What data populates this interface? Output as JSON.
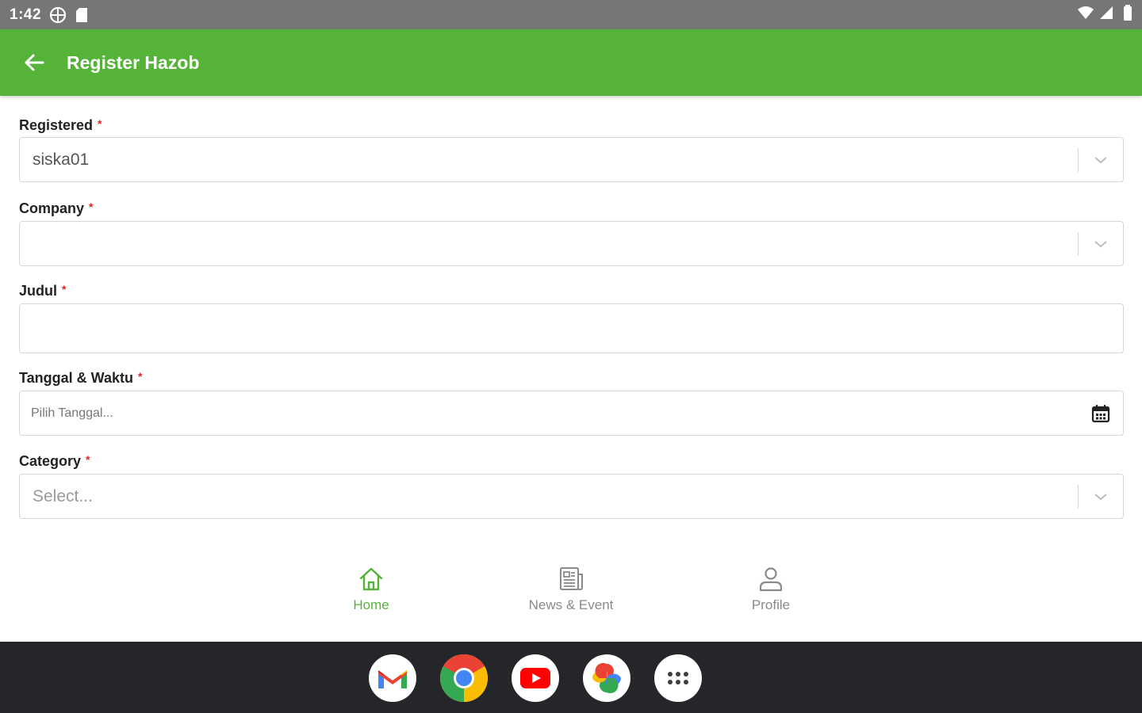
{
  "status_bar": {
    "time": "1:42"
  },
  "app_bar": {
    "title": "Register Hazob"
  },
  "form": {
    "registered": {
      "label": "Registered",
      "required_mark": "*",
      "value": "siska01"
    },
    "company": {
      "label": "Company",
      "required_mark": "*",
      "value": ""
    },
    "judul": {
      "label": "Judul",
      "required_mark": "*",
      "value": ""
    },
    "tanggal": {
      "label": "Tanggal & Waktu",
      "required_mark": "*",
      "placeholder": "Pilih Tanggal..."
    },
    "category": {
      "label": "Category",
      "required_mark": "*",
      "placeholder": "Select..."
    }
  },
  "bottom_nav": {
    "items": [
      {
        "label": "Home",
        "icon": "home-icon",
        "active": true
      },
      {
        "label": "News & Event",
        "icon": "newspaper-icon",
        "active": false
      },
      {
        "label": "Profile",
        "icon": "person-icon",
        "active": false
      }
    ],
    "active_color": "#56b33a",
    "inactive_color": "#8a8a8a"
  },
  "dock": {
    "apps": [
      "gmail-icon",
      "chrome-icon",
      "youtube-icon",
      "photos-icon",
      "app-drawer-icon"
    ]
  },
  "colors": {
    "primary": "#56b33a",
    "required": "#e02424"
  }
}
